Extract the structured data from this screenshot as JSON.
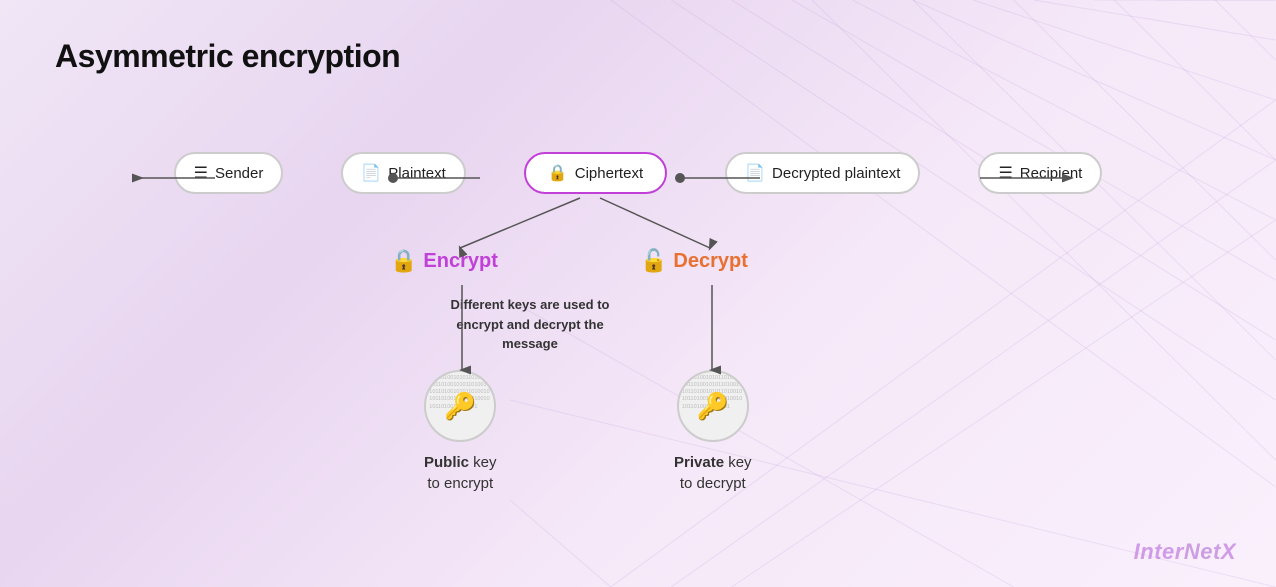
{
  "title": "Asymmetric encryption",
  "nodes": [
    {
      "id": "sender",
      "label": "Sender",
      "icon": "≡",
      "style": "normal"
    },
    {
      "id": "plaintext",
      "label": "Plaintext",
      "icon": "🗋",
      "style": "normal"
    },
    {
      "id": "ciphertext",
      "label": "Ciphertext",
      "icon": "🗋",
      "style": "highlighted"
    },
    {
      "id": "decrypted",
      "label": "Decrypted plaintext",
      "icon": "🗋",
      "style": "normal"
    },
    {
      "id": "recipient",
      "label": "Recipient",
      "icon": "≡",
      "style": "normal"
    }
  ],
  "encrypt": {
    "label": "Encrypt",
    "icon": "🔒",
    "color": "#c040d8"
  },
  "decrypt": {
    "label": "Decrypt",
    "icon": "🔓",
    "color": "#e87030"
  },
  "info_text": "Different keys are used to encrypt and decrypt the message",
  "public_key": {
    "label_bold": "Public",
    "label_rest": " key\nto encrypt"
  },
  "private_key": {
    "label_bold": "Private",
    "label_rest": " key\nto decrypt"
  },
  "brand": {
    "prefix": "Inter",
    "italic": "Net",
    "suffix": "X"
  },
  "binary_text": "001101001010110100101011010010101101001010110100101011010010101101001010110100101011010010101101001010"
}
